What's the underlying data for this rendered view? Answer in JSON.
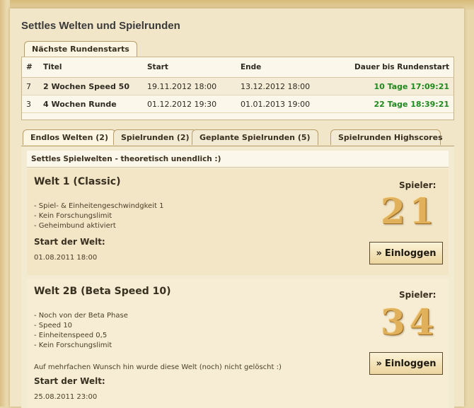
{
  "page": {
    "title": "Settles Welten und Spielrunden"
  },
  "rounds": {
    "tab_label": "Nächste Rundenstarts",
    "headers": [
      "#",
      "Titel",
      "Start",
      "Ende",
      "Dauer bis Rundenstart"
    ],
    "rows": [
      {
        "num": "7",
        "title": "2 Wochen Speed 50",
        "start": "19.11.2012 18:00",
        "end": "13.12.2012 18:00",
        "countdown": "10 Tage 17:09:21"
      },
      {
        "num": "3",
        "title": "4 Wochen Runde",
        "start": "01.12.2012 19:30",
        "end": "01.01.2013 19:00",
        "countdown": "22 Tage 18:39:21"
      }
    ]
  },
  "tabs": {
    "endless": "Endlos Welten (2)",
    "rounds": "Spielrunden (2)",
    "planned": "Geplante Spielrunden (5)",
    "highscores": "Spielrunden Highscores"
  },
  "worlds": {
    "subtitle": "Settles Spielwelten - theoretisch unendlich :)",
    "players_label": "Spieler:",
    "start_label": "Start der Welt:",
    "login_label": "Einloggen",
    "login_arrow": "»",
    "items": [
      {
        "name": "Welt 1 (Classic)",
        "features": [
          "- Spiel- & Einheitengeschwindgkeit 1",
          "- Kein Forschungslimit",
          "- Geheimbund aktiviert"
        ],
        "note": "",
        "start": "01.08.2011 18:00",
        "players": "21"
      },
      {
        "name": "Welt 2B (Beta Speed 10)",
        "features": [
          "- Noch von der Beta Phase",
          "- Speed 10",
          "- Einheitenspeed 0,5",
          "- Kein Forschungslimit"
        ],
        "note": "Auf mehrfachen Wunsch hin wurde diese Welt (noch) nicht gelöscht :)",
        "start": "25.08.2011 23:00",
        "players": "34"
      }
    ]
  },
  "colors": {
    "countdown": "#1e8a1e",
    "players_gold": "#e0b05a",
    "parchment": "#f1e6c8"
  }
}
